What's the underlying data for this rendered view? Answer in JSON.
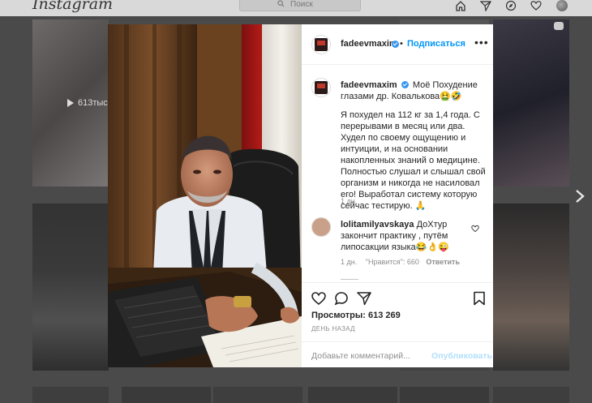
{
  "topbar": {
    "logo": "Instagram",
    "search_placeholder": "Поиск"
  },
  "grid": {
    "tile_views": "613тыс."
  },
  "post": {
    "author": "fadeevmaxim",
    "separator": "•",
    "follow_label": "Подписаться",
    "more_label": "•••",
    "caption_title": "Моё Похудение глазами др. Ковалькова🤮🤣",
    "caption_body": "Я похудел на 112 кг за 1,4 года. С перерывами в месяц или два. Худел по своему ощущению и интуиции, и на основании накопленных знаний о медицине. Полностью слушал и слышал свой организм и никогда не насиловал его! Выработал систему которую сейчас тестирую. 🙏",
    "caption_time": "1 дн.",
    "comment": {
      "author": "lolitamilyavskaya",
      "text": "ДоХтур закончит практику , путём липосакции языка😂👌😜",
      "time": "1 дн.",
      "likes": "\"Нравится\": 660",
      "reply_label": "Ответить"
    },
    "views_label": "Просмотры:",
    "views_count": "613 269",
    "ago": "ДЕНЬ НАЗАД",
    "add_comment_placeholder": "Добавьте комментарий...",
    "publish_label": "Опубликовать"
  },
  "colors": {
    "link_blue": "#0095f6",
    "publish_disabled": "#b2dffc",
    "verified": "#3897f0"
  }
}
